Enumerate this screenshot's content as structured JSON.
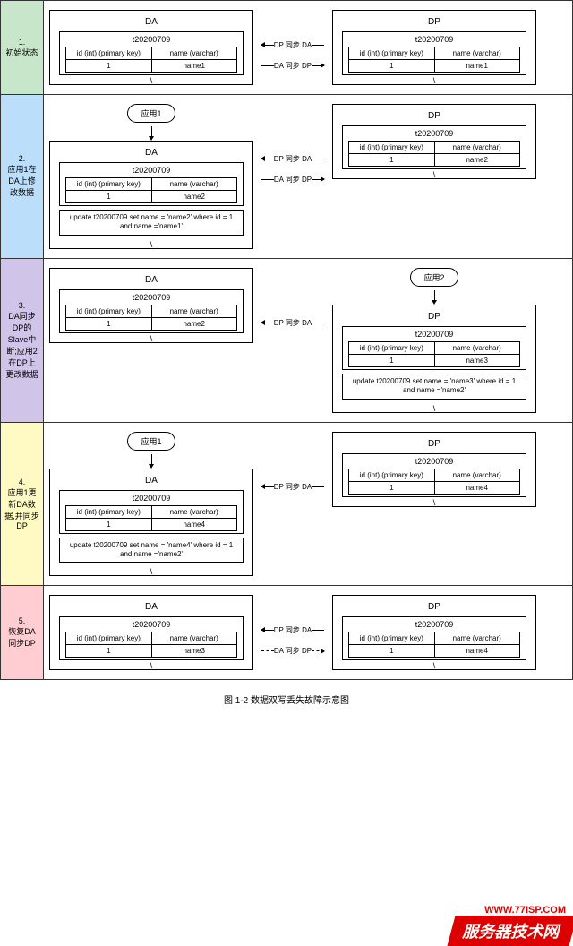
{
  "caption": "图 1-2 数据双写丢失故障示意图",
  "watermark": {
    "url": "WWW.77ISP.COM",
    "banner": "服务器技术网"
  },
  "common": {
    "tableName": "t20200709",
    "col1": "id (int) (primary key)",
    "col2": "name (varchar)",
    "id": "1",
    "backslash": "\\",
    "syncDPtoDA": "DP 同步 DA",
    "syncDAtoDP": "DA 同步 DP",
    "app1": "应用1",
    "app2": "应用2",
    "DA": "DA",
    "DP": "DP"
  },
  "sections": [
    {
      "label": "1.\n初始状态",
      "color": "c1",
      "leftApp": null,
      "rightApp": null,
      "leftName": "name1",
      "rightName": "name1",
      "leftSql": null,
      "rightSql": null,
      "sync1": true,
      "sync2": true,
      "sync2dashed": false
    },
    {
      "label": "2.\n应用1在DA上修改数据",
      "color": "c2",
      "leftApp": "app1",
      "rightApp": null,
      "leftName": "name2",
      "rightName": "name2",
      "leftSql": "update t20200709 set name = 'name2' where id = 1 and name ='name1'",
      "rightSql": null,
      "sync1": true,
      "sync2": true,
      "sync2dashed": false
    },
    {
      "label": "3.\nDA同步DP的Slave中断;应用2在DP上更改数据",
      "color": "c3",
      "leftApp": null,
      "rightApp": "app2",
      "leftName": "name2",
      "rightName": "name3",
      "leftSql": null,
      "rightSql": "update t20200709 set name = 'name3' where id = 1 and name ='name2'",
      "sync1": true,
      "sync2": false,
      "sync2dashed": false
    },
    {
      "label": "4.\n应用1更新DA数据,并同步DP",
      "color": "c4",
      "leftApp": "app1",
      "rightApp": null,
      "leftName": "name4",
      "rightName": "name4",
      "leftSql": "update t20200709 set name = 'name4' where id = 1 and name ='name2'",
      "rightSql": null,
      "sync1": true,
      "sync2": false,
      "sync2dashed": false
    },
    {
      "label": "5.\n恢复DA同步DP",
      "color": "c5",
      "leftApp": null,
      "rightApp": null,
      "leftName": "name3",
      "rightName": "name4",
      "leftSql": null,
      "rightSql": null,
      "sync1": true,
      "sync2": true,
      "sync2dashed": true
    }
  ]
}
